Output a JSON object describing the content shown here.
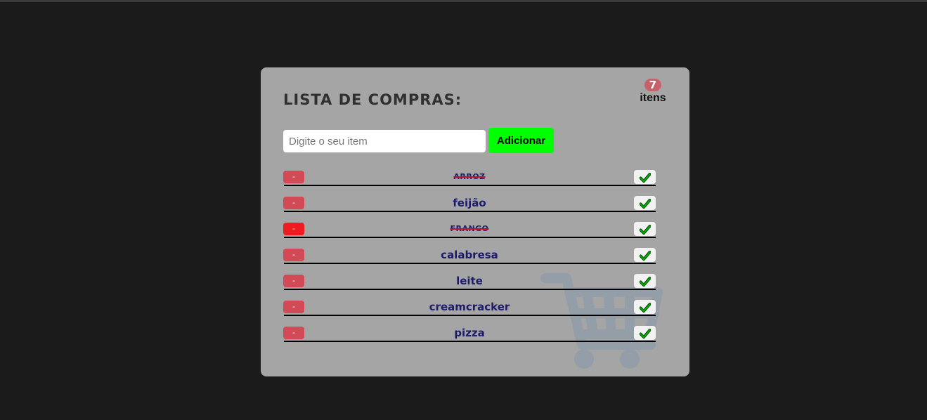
{
  "title": "LISTA DE COMPRAS:",
  "counter": {
    "count": "7",
    "label": "itens"
  },
  "input": {
    "placeholder": "Digite o seu item",
    "value": ""
  },
  "add_button_label": "Adicionar",
  "items": [
    {
      "name": "ARROZ",
      "done": true,
      "remove_label": "-"
    },
    {
      "name": "feijão",
      "done": false,
      "remove_label": "-"
    },
    {
      "name": "FRANGO",
      "done": true,
      "remove_label": "-"
    },
    {
      "name": "calabresa",
      "done": false,
      "remove_label": "-"
    },
    {
      "name": "leite",
      "done": false,
      "remove_label": "-"
    },
    {
      "name": "creamcracker",
      "done": false,
      "remove_label": "-"
    },
    {
      "name": "pizza",
      "done": false,
      "remove_label": "-"
    }
  ],
  "icons": {
    "check": "check-icon",
    "background": "shopping-cart-icon",
    "remove": "minus-icon"
  },
  "colors": {
    "page_bg": "#1b1b1b",
    "card_bg": "#a5a5a5",
    "add_button": "#00ff00",
    "remove_button": "#d14a55",
    "remove_button_active": "#f01b1f",
    "item_text": "#1d1b6b",
    "badge": "#c9616d",
    "check": "#00a000"
  }
}
